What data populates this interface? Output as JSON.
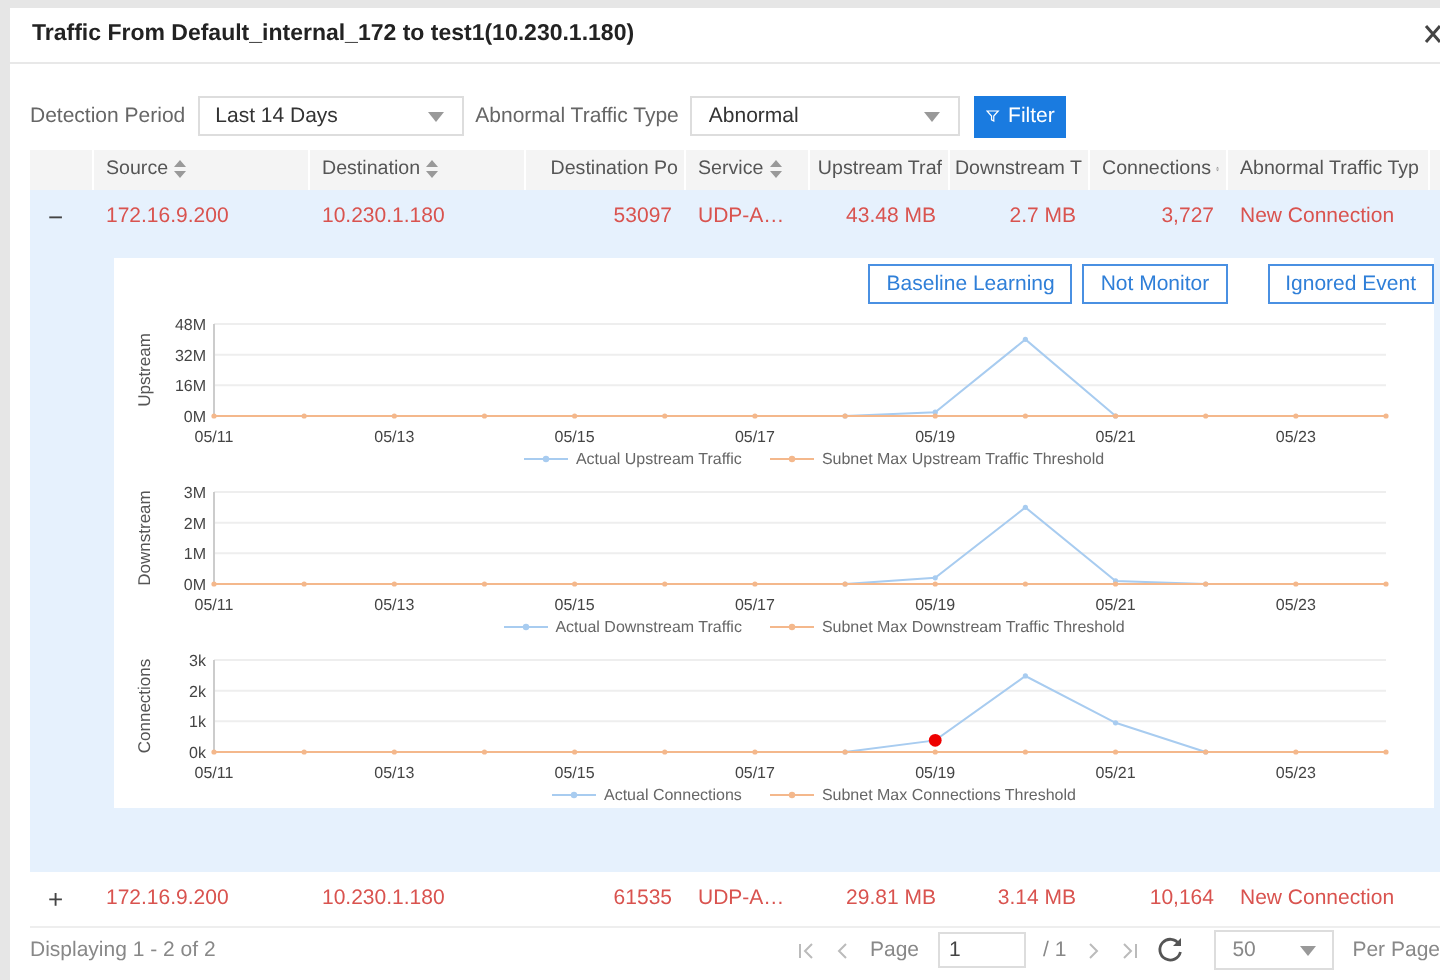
{
  "window": {
    "title": "Traffic From Default_internal_172 to test1(10.230.1.180)"
  },
  "filters": [
    {
      "label": "Detection Period",
      "value": "Last 14 Days"
    },
    {
      "label": "Abnormal Traffic Type",
      "value": "Abnormal"
    }
  ],
  "filter_button": "Filter",
  "table": {
    "columns": [
      "Source",
      "Destination",
      "Destination Po",
      "Service",
      "Upstream Traf",
      "Downstream T",
      "Connections",
      "Abnormal Traffic Typ"
    ],
    "rows": [
      {
        "toggle": "−",
        "expanded": true,
        "cells": [
          "172.16.9.200",
          "10.230.1.180",
          "53097",
          "UDP-A…",
          "43.48 MB",
          "2.7 MB",
          "3,727",
          "New Connection"
        ]
      },
      {
        "toggle": "+",
        "expanded": false,
        "cells": [
          "172.16.9.200",
          "10.230.1.180",
          "61535",
          "UDP-A…",
          "29.81 MB",
          "3.14 MB",
          "10,164",
          "New Connection"
        ]
      }
    ]
  },
  "detail": {
    "actions": [
      "Baseline Learning",
      "Not Monitor",
      "Ignored Event"
    ],
    "charts": [
      {
        "chart_data": {
          "type": "line",
          "ylabel": "Upstream",
          "legend": "bottom",
          "categories": [
            "05/11",
            null,
            "05/13",
            null,
            "05/15",
            null,
            "05/17",
            null,
            "05/19",
            null,
            "05/21",
            null,
            "05/23",
            null
          ],
          "ylim": [
            0,
            48
          ],
          "yticks": [
            {
              "value": 0,
              "label": "0M"
            },
            {
              "value": 16,
              "label": "16M"
            },
            {
              "value": 32,
              "label": "32M"
            },
            {
              "value": 48,
              "label": "48M"
            }
          ],
          "series": [
            {
              "name": "Actual Upstream Traffic",
              "color": "#a8ccf0",
              "values": [
                null,
                null,
                null,
                null,
                null,
                null,
                null,
                0,
                2,
                40,
                0,
                null,
                null,
                null
              ]
            },
            {
              "name": "Subnet Max Upstream Traffic Threshold",
              "color": "#f4b88c",
              "values": [
                0,
                0,
                0,
                0,
                0,
                0,
                0,
                0,
                0,
                0,
                0,
                0,
                0,
                0
              ]
            }
          ]
        }
      },
      {
        "chart_data": {
          "type": "line",
          "ylabel": "Downstream",
          "legend": "bottom",
          "categories": [
            "05/11",
            null,
            "05/13",
            null,
            "05/15",
            null,
            "05/17",
            null,
            "05/19",
            null,
            "05/21",
            null,
            "05/23",
            null
          ],
          "ylim": [
            0,
            3
          ],
          "yticks": [
            {
              "value": 0,
              "label": "0M"
            },
            {
              "value": 1,
              "label": "1M"
            },
            {
              "value": 2,
              "label": "2M"
            },
            {
              "value": 3,
              "label": "3M"
            }
          ],
          "series": [
            {
              "name": "Actual Downstream Traffic",
              "color": "#a8ccf0",
              "values": [
                null,
                null,
                null,
                null,
                null,
                null,
                null,
                0,
                0.2,
                2.5,
                0.1,
                0,
                null,
                null
              ]
            },
            {
              "name": "Subnet Max Downstream Traffic Threshold",
              "color": "#f4b88c",
              "values": [
                0,
                0,
                0,
                0,
                0,
                0,
                0,
                0,
                0,
                0,
                0,
                0,
                0,
                0
              ]
            }
          ]
        }
      },
      {
        "chart_data": {
          "type": "line",
          "ylabel": "Connections",
          "legend": "bottom",
          "categories": [
            "05/11",
            null,
            "05/13",
            null,
            "05/15",
            null,
            "05/17",
            null,
            "05/19",
            null,
            "05/21",
            null,
            "05/23",
            null
          ],
          "ylim": [
            0,
            3000
          ],
          "yticks": [
            {
              "value": 0,
              "label": "0k"
            },
            {
              "value": 1000,
              "label": "1k"
            },
            {
              "value": 2000,
              "label": "2k"
            },
            {
              "value": 3000,
              "label": "3k"
            }
          ],
          "series": [
            {
              "name": "Actual Connections",
              "color": "#a8ccf0",
              "values": [
                null,
                null,
                null,
                null,
                null,
                null,
                null,
                0,
                380,
                2480,
                950,
                0,
                null,
                null
              ]
            },
            {
              "name": "Subnet Max Connections Threshold",
              "color": "#f4b88c",
              "values": [
                0,
                0,
                0,
                0,
                0,
                0,
                0,
                0,
                0,
                0,
                0,
                0,
                0,
                0
              ]
            }
          ],
          "annotations": [
            {
              "x": "05/19"
            }
          ]
        }
      }
    ]
  },
  "status_bar": {
    "summary": "Displaying 1 - 2 of 2",
    "page_label": "Page",
    "page": "1",
    "total": "/ 1",
    "per_page": "50",
    "per_page_label": "Per Page"
  }
}
